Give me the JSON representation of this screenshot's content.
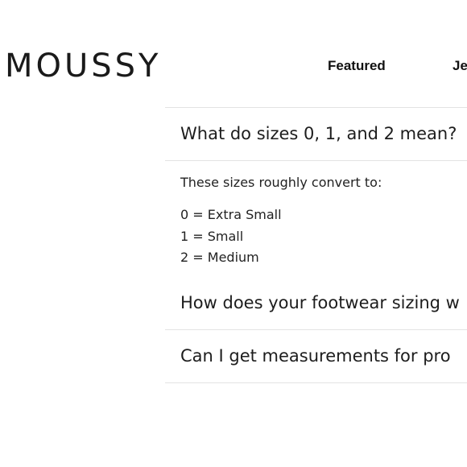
{
  "header": {
    "logo": "MOUSSY",
    "nav": [
      {
        "label": "Featured"
      },
      {
        "label": "Je"
      }
    ]
  },
  "faq": {
    "items": [
      {
        "question": "What do sizes 0, 1, and 2 mean?",
        "expanded": true,
        "answer": {
          "intro": "These sizes roughly convert to:",
          "list": [
            "0 = Extra Small",
            "1 = Small",
            "2 = Medium"
          ]
        }
      },
      {
        "question": "How does your footwear sizing w",
        "expanded": false
      },
      {
        "question": "Can I get measurements for pro",
        "expanded": false
      }
    ]
  }
}
